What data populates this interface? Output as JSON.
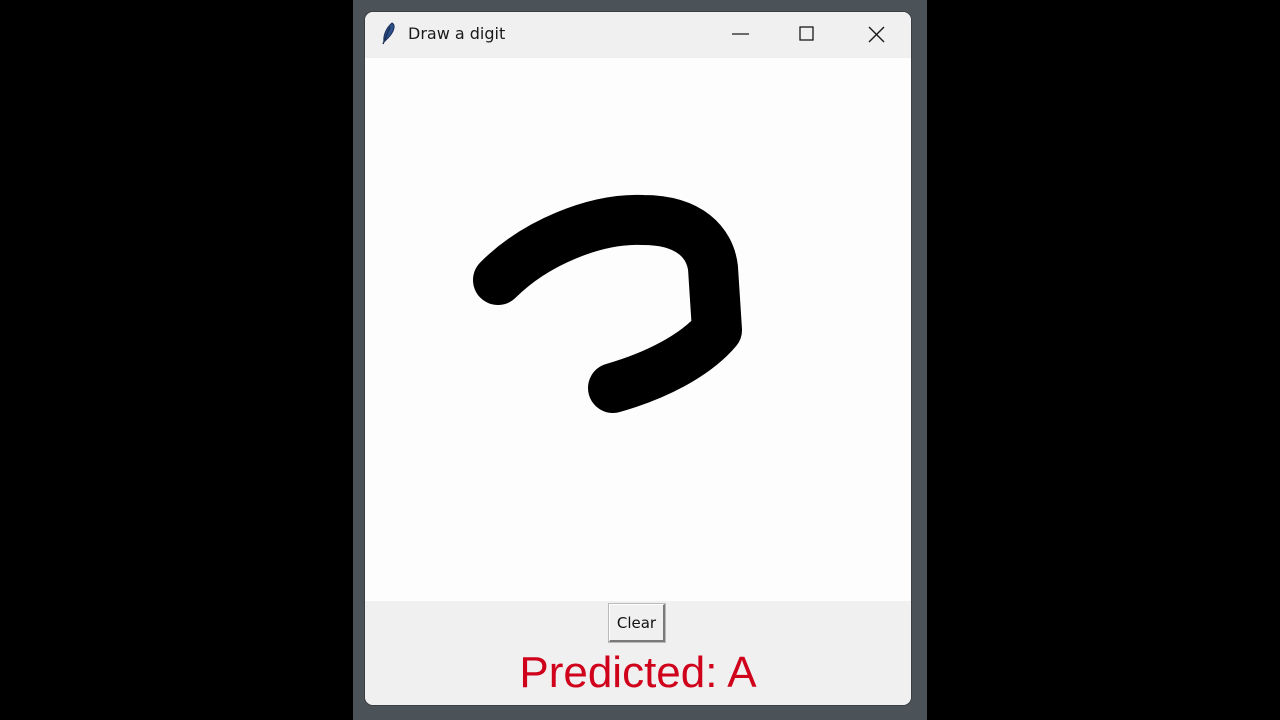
{
  "window": {
    "title": "Draw a digit",
    "icon": "feather-icon",
    "controls": {
      "minimize": "minimize-icon",
      "maximize": "maximize-icon",
      "close": "close-icon"
    }
  },
  "toolbar": {
    "clear_label": "Clear"
  },
  "result": {
    "prediction_text": "Predicted: A",
    "color": "#d0021b"
  },
  "colors": {
    "canvas_background": "#fdfdfd",
    "stroke": "#000000",
    "window_chrome": "#f0f0f0"
  }
}
